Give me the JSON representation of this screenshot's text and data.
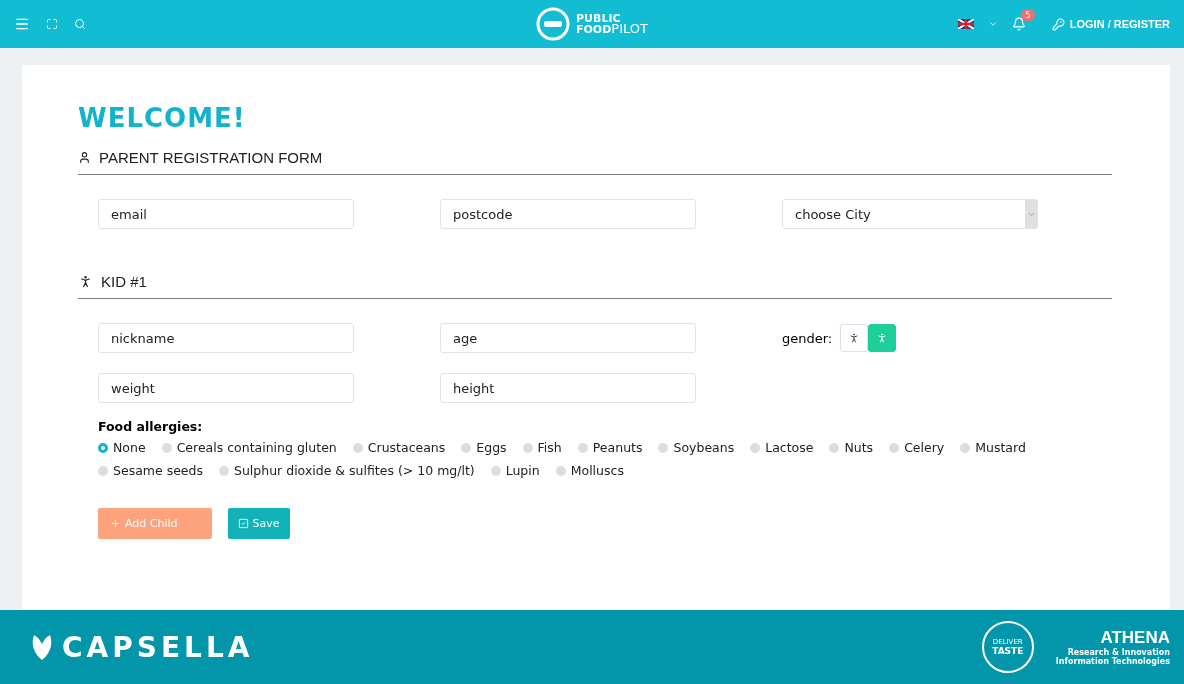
{
  "topbar": {
    "logo_top": "PUBLIC",
    "logo_bottom": "FOOD",
    "logo_suffix": "PILOT",
    "notifications": "5",
    "login": "LOGIN / REGISTER"
  },
  "welcome": "WELCOME!",
  "parent_section": {
    "title": "PARENT REGISTRATION FORM",
    "fields": [
      {
        "kind": "input",
        "placeholder": "email"
      },
      {
        "kind": "input",
        "placeholder": "postcode"
      },
      {
        "kind": "select",
        "value": "choose City"
      }
    ]
  },
  "kid_section": {
    "title": "KID #1",
    "fields": [
      {
        "placeholder": "nickname"
      },
      {
        "placeholder": "age"
      },
      {
        "placeholder": "weight"
      },
      {
        "placeholder": "height"
      }
    ],
    "gender": {
      "label": "gender:",
      "options": [
        {
          "selected": false
        },
        {
          "selected": true
        }
      ]
    },
    "allergies_label": "Food allergies:",
    "allergies": [
      {
        "label": "None",
        "selected": true
      },
      {
        "label": "Cereals containing gluten",
        "selected": false
      },
      {
        "label": "Crustaceans",
        "selected": false
      },
      {
        "label": "Eggs",
        "selected": false
      },
      {
        "label": "Fish",
        "selected": false
      },
      {
        "label": "Peanuts",
        "selected": false
      },
      {
        "label": "Soybeans",
        "selected": false
      },
      {
        "label": "Lactose",
        "selected": false
      },
      {
        "label": "Nuts",
        "selected": false
      },
      {
        "label": "Celery",
        "selected": false
      },
      {
        "label": "Mustard",
        "selected": false
      },
      {
        "label": "Sesame seeds",
        "selected": false
      },
      {
        "label": "Sulphur dioxide & sulfites (> 10 mg/lt)",
        "selected": false
      },
      {
        "label": "Lupin",
        "selected": false
      },
      {
        "label": "Molluscs",
        "selected": false
      }
    ]
  },
  "buttons": [
    {
      "label": "Add Child",
      "kind": "add"
    },
    {
      "label": "Save",
      "kind": "save"
    }
  ],
  "footer": {
    "brand": "CAPSELLA",
    "taste_top": "DELIVER",
    "taste": "TASTE",
    "athena": "ATHENA",
    "athena_line1": "Research & Innovation",
    "athena_line2": "Information Technologies"
  }
}
